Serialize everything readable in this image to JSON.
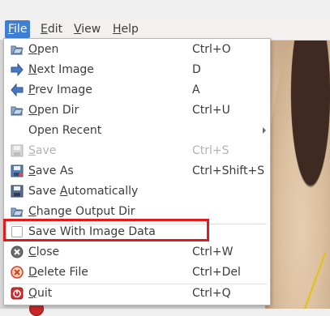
{
  "menubar": {
    "items": [
      {
        "label": "File",
        "mnemonic": "F",
        "rest": "ile",
        "active": true
      },
      {
        "label": "Edit",
        "mnemonic": "E",
        "rest": "dit"
      },
      {
        "label": "View",
        "mnemonic": "V",
        "rest": "iew"
      },
      {
        "label": "Help",
        "mnemonic": "H",
        "rest": "elp"
      }
    ]
  },
  "file_menu": {
    "items": [
      {
        "pre": "",
        "mn": "O",
        "post": "pen",
        "shortcut": "Ctrl+O",
        "icon": "open-folder-icon"
      },
      {
        "pre": "",
        "mn": "N",
        "post": "ext Image",
        "shortcut": "D",
        "icon": "arrow-right-icon"
      },
      {
        "pre": "",
        "mn": "P",
        "post": "rev Image",
        "shortcut": "A",
        "icon": "arrow-left-icon"
      },
      {
        "pre": "",
        "mn": "O",
        "post": "pen Dir",
        "shortcut": "Ctrl+U",
        "icon": "open-folder-icon"
      },
      {
        "pre": "Open Recent",
        "mn": "",
        "post": "",
        "shortcut": "",
        "icon": "",
        "submenu": true
      },
      {
        "pre": "",
        "mn": "S",
        "post": "ave",
        "shortcut": "Ctrl+S",
        "icon": "save-icon",
        "disabled": true
      },
      {
        "pre": "",
        "mn": "S",
        "post": "ave As",
        "shortcut": "Ctrl+Shift+S",
        "icon": "save-as-icon"
      },
      {
        "pre": "Save ",
        "mn": "A",
        "post": "utomatically",
        "shortcut": "",
        "icon": "save-icon"
      },
      {
        "pre": "",
        "mn": "C",
        "post": "hange Output Dir",
        "shortcut": "",
        "icon": "open-folder-icon"
      },
      {
        "pre": "Save With Image Data",
        "mn": "",
        "post": "",
        "shortcut": "",
        "icon": "checkbox-icon"
      },
      {
        "pre": "",
        "mn": "C",
        "post": "lose",
        "shortcut": "Ctrl+W",
        "icon": "close-icon"
      },
      {
        "pre": "",
        "mn": "D",
        "post": "elete File",
        "shortcut": "Ctrl+Del",
        "icon": "delete-icon"
      },
      {
        "pre": "",
        "mn": "Q",
        "post": "uit",
        "shortcut": "Ctrl+Q",
        "icon": "quit-icon"
      }
    ]
  },
  "colors": {
    "accent": "#3e7fd3",
    "highlight_box": "#e31a1a"
  }
}
